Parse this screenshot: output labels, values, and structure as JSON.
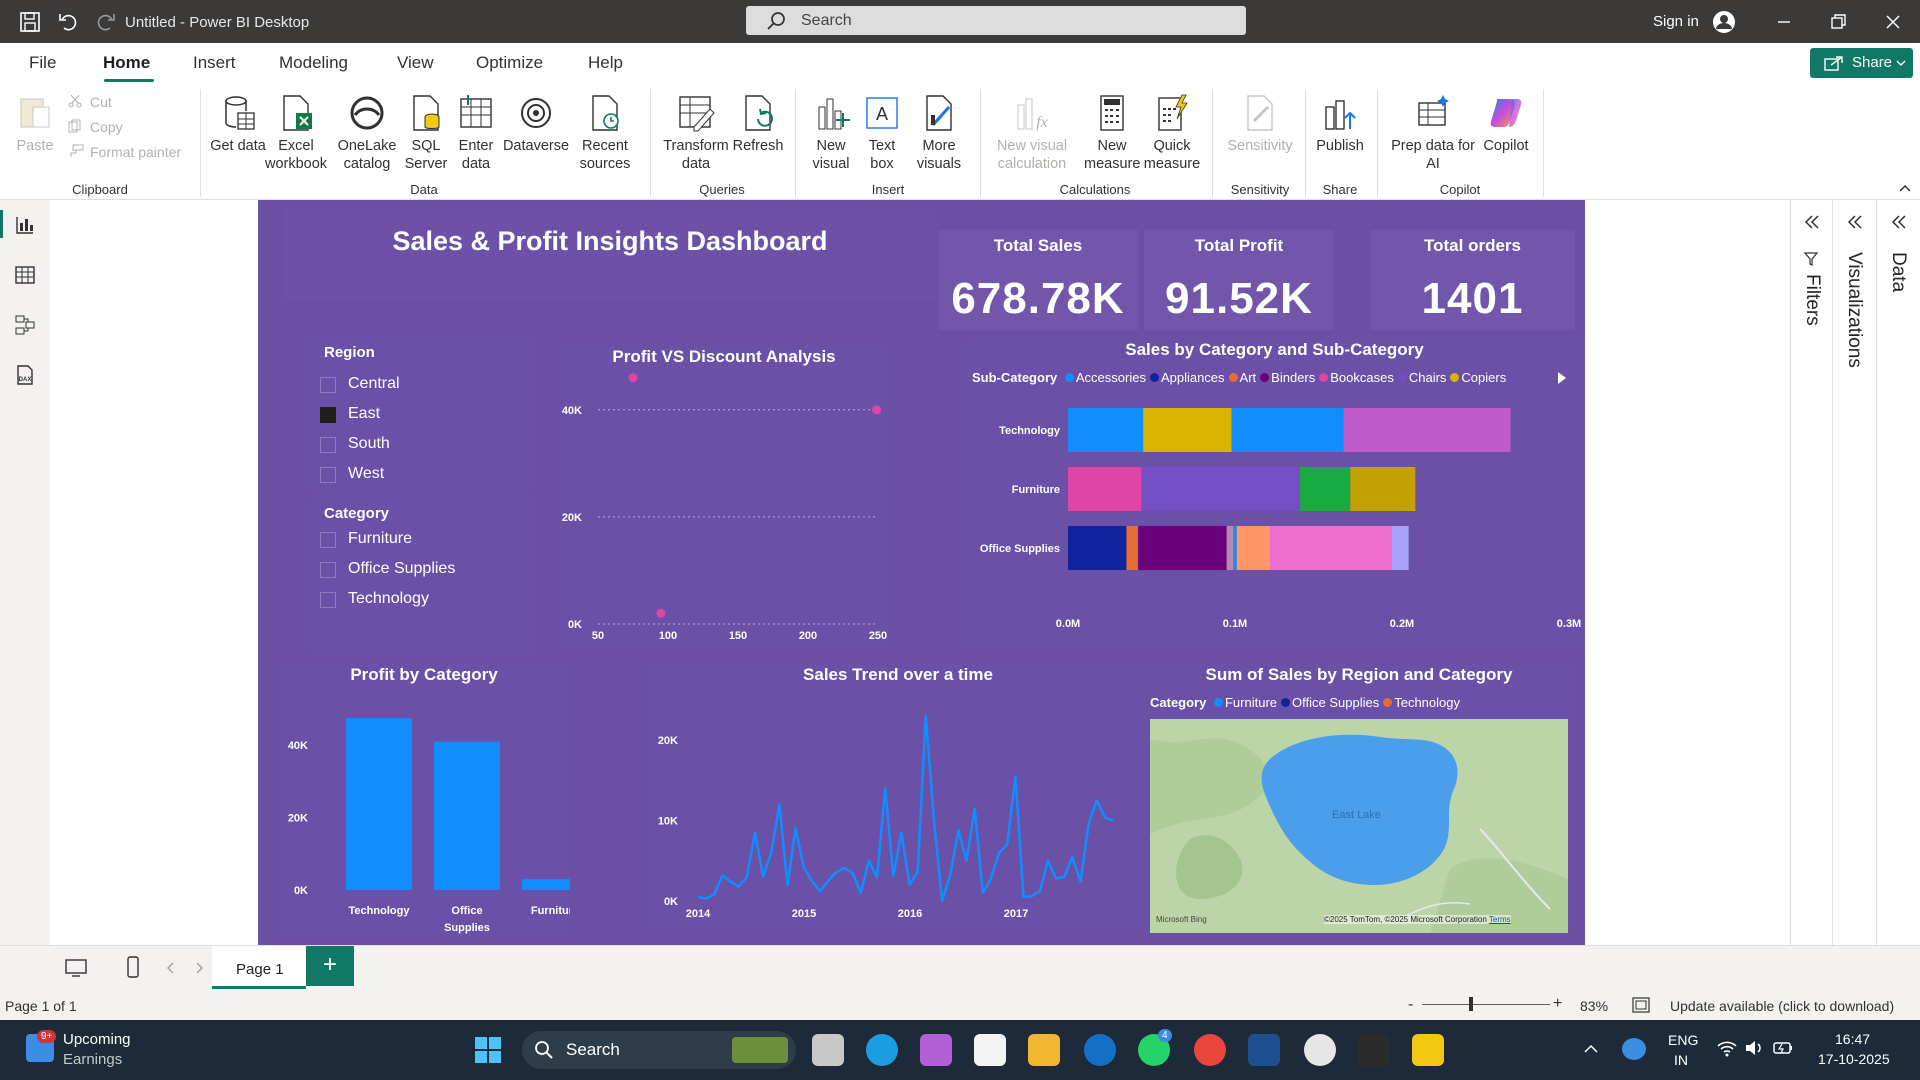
{
  "window": {
    "title": "Untitled - Power BI Desktop",
    "search_placeholder": "Search",
    "signin": "Sign in"
  },
  "menu": [
    "File",
    "Home",
    "Insert",
    "Modeling",
    "View",
    "Optimize",
    "Help"
  ],
  "share": "Share",
  "ribbon": {
    "paste": "Paste",
    "cut": "Cut",
    "copy": "Copy",
    "format_painter": "Format painter",
    "clipboard": "Clipboard",
    "get_data": "Get data",
    "excel": "Excel workbook",
    "onelake": "OneLake catalog",
    "sql": "SQL Server",
    "enter": "Enter data",
    "dataverse": "Dataverse",
    "recent": "Recent sources",
    "data": "Data",
    "transform": "Transform data",
    "refresh": "Refresh",
    "queries": "Queries",
    "new_visual": "New visual",
    "text_box": "Text box",
    "more_visuals": "More visuals",
    "insert": "Insert",
    "new_visual_calc": "New visual calculation",
    "new_measure": "New measure",
    "quick_measure": "Quick measure",
    "calculations": "Calculations",
    "sensitivity_btn": "Sensitivity",
    "sensitivity": "Sensitivity",
    "publish": "Publish",
    "share_grp": "Share",
    "prep": "Prep data for AI",
    "copilot_btn": "Copilot",
    "copilot": "Copilot"
  },
  "panes": {
    "filters": "Filters",
    "visualizations": "Visualizations",
    "data": "Data"
  },
  "report": {
    "title": "Sales & Profit Insights Dashboard",
    "kpis": [
      {
        "label": "Total Sales",
        "value": "678.78K"
      },
      {
        "label": "Total Profit",
        "value": "91.52K"
      },
      {
        "label": "Total orders",
        "value": "1401"
      }
    ],
    "region_slicer": {
      "label": "Region",
      "items": [
        "Central",
        "East",
        "South",
        "West"
      ],
      "selected": "East"
    },
    "category_slicer": {
      "label": "Category",
      "items": [
        "Furniture",
        "Office Supplies",
        "Technology"
      ]
    },
    "profit_discount_title": "Profit VS Discount Analysis",
    "subcat_title": "Sales by Category and Sub-Category",
    "subcat_legend_label": "Sub-Category",
    "subcat_legend": [
      {
        "name": "Accessories",
        "color": "#118dff"
      },
      {
        "name": "Appliances",
        "color": "#12239e"
      },
      {
        "name": "Art",
        "color": "#e66c37"
      },
      {
        "name": "Binders",
        "color": "#6b007b"
      },
      {
        "name": "Bookcases",
        "color": "#e044a7"
      },
      {
        "name": "Chairs",
        "color": "#744ec2"
      },
      {
        "name": "Copiers",
        "color": "#d9b300"
      }
    ],
    "profit_cat_title": "Profit by Category",
    "trend_title": "Sales Trend over a time",
    "map_title": "Sum of Sales by Region and Category",
    "map_legend_label": "Category",
    "map_legend": [
      {
        "name": "Furniture",
        "color": "#118dff"
      },
      {
        "name": "Office Supplies",
        "color": "#12239e"
      },
      {
        "name": "Technology",
        "color": "#e66c37"
      }
    ],
    "map_lake": "East Lake",
    "map_bing": "Microsoft Bing",
    "map_attrib": "©2025 TomTom, ©2025 Microsoft Corporation",
    "map_terms": "Terms"
  },
  "chart_data": [
    {
      "type": "scatter",
      "title": "Profit VS Discount Analysis",
      "x": [
        75,
        95,
        249
      ],
      "y": [
        46000,
        2000,
        40000
      ],
      "xlim": [
        50,
        250
      ],
      "ylim": [
        0,
        45000
      ],
      "xticks": [
        "50",
        "100",
        "150",
        "200",
        "250"
      ],
      "yticks": [
        "0K",
        "20K",
        "40K"
      ]
    },
    {
      "type": "bar",
      "orientation": "horizontal",
      "stacked": true,
      "title": "Sales by Category and Sub-Category",
      "categories": [
        "Technology",
        "Furniture",
        "Office Supplies"
      ],
      "xlim": [
        0,
        0.3
      ],
      "xticks": [
        "0.0M",
        "0.1M",
        "0.2M",
        "0.3M"
      ],
      "series": [
        {
          "category": "Technology",
          "segments": [
            {
              "color": "#118dff",
              "value": 0.045
            },
            {
              "color": "#d9b300",
              "value": 0.053
            },
            {
              "color": "#118dff",
              "value": 0.067
            },
            {
              "color": "#c05bc8",
              "value": 0.1
            }
          ]
        },
        {
          "category": "Furniture",
          "segments": [
            {
              "color": "#e044a7",
              "value": 0.044
            },
            {
              "color": "#744ec2",
              "value": 0.095
            },
            {
              "color": "#1aab40",
              "value": 0.03
            },
            {
              "color": "#c3a100",
              "value": 0.039
            }
          ]
        },
        {
          "category": "Office Supplies",
          "segments": [
            {
              "color": "#12239e",
              "value": 0.035
            },
            {
              "color": "#e66c37",
              "value": 0.007
            },
            {
              "color": "#6b007b",
              "value": 0.053
            },
            {
              "color": "#b887ad",
              "value": 0.004
            },
            {
              "color": "#118dff",
              "value": 0.002
            },
            {
              "color": "#fe9666",
              "value": 0.02
            },
            {
              "color": "#ee6fcf",
              "value": 0.073
            },
            {
              "color": "#a9a1f9",
              "value": 0.01
            }
          ]
        }
      ]
    },
    {
      "type": "bar",
      "title": "Profit by Category",
      "categories": [
        "Technology",
        "Office Supplies",
        "Furniture"
      ],
      "values": [
        47500,
        41000,
        3000
      ],
      "ylim": [
        0,
        50000
      ],
      "yticks": [
        "0K",
        "20K",
        "40K"
      ]
    },
    {
      "type": "line",
      "title": "Sales Trend over a time",
      "xticks": [
        "2014",
        "2015",
        "2016",
        "2017"
      ],
      "ylim": [
        0,
        24000
      ],
      "yticks": [
        "0K",
        "10K",
        "20K"
      ],
      "values": [
        500,
        300,
        800,
        3200,
        2400,
        1800,
        3000,
        8500,
        3000,
        6000,
        12000,
        2000,
        9000,
        4200,
        2500,
        1200,
        2500,
        3600,
        4100,
        3500,
        1000,
        5000,
        2900,
        14000,
        3100,
        8500,
        2000,
        3700,
        23000,
        10000,
        0,
        3300,
        8800,
        5000,
        11500,
        1000,
        2800,
        6000,
        7000,
        15500,
        500,
        600,
        1200,
        5000,
        2800,
        3000,
        5500,
        2400,
        9600,
        12500,
        10400,
        10000
      ]
    },
    {
      "type": "map",
      "title": "Sum of Sales by Region and Category"
    }
  ],
  "pagebar": {
    "page": "Page 1",
    "add": "+"
  },
  "status": {
    "page_of": "Page 1 of 1",
    "zoom": "83%",
    "update": "Update available (click to download)"
  },
  "taskbar": {
    "weather_badge": "9+",
    "weather_line1": "Upcoming",
    "weather_line2": "Earnings",
    "search": "Search",
    "lang1": "ENG",
    "lang2": "IN",
    "time": "16:47",
    "date": "17-10-2025",
    "whatsapp_badge": "4"
  }
}
